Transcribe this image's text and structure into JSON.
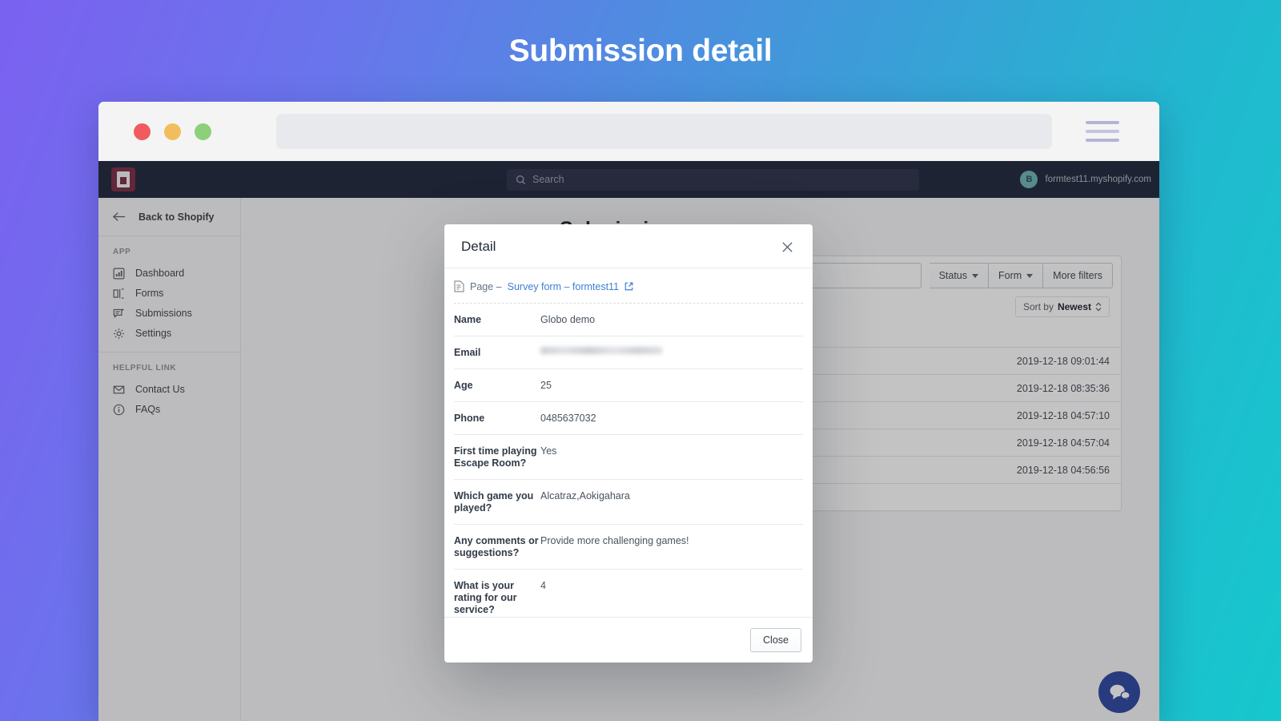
{
  "banner": {
    "title": "Submission detail"
  },
  "browser": {
    "traffic_lights": [
      {
        "name": "close",
        "color": "#fc5d60"
      },
      {
        "name": "minimize",
        "color": "#fdc75f"
      },
      {
        "name": "zoom",
        "color": "#93da7e"
      }
    ],
    "url_value": "",
    "menu_icon": "hamburger-menu-icon"
  },
  "topnav": {
    "logo_icon": "globo-forms-logo",
    "search": {
      "placeholder": "Search",
      "value": "",
      "icon": "search-icon"
    },
    "account": {
      "initial": "B",
      "name": "formtest11.myshopify.com"
    }
  },
  "sidebar": {
    "back": {
      "label": "Back to Shopify",
      "icon": "arrow-left-icon"
    },
    "groups": [
      {
        "heading": "APP",
        "items": [
          {
            "label": "Dashboard",
            "icon": "chart-bar-icon"
          },
          {
            "label": "Forms",
            "icon": "form-icon"
          },
          {
            "label": "Submissions",
            "icon": "submissions-icon"
          },
          {
            "label": "Settings",
            "icon": "gear-icon"
          }
        ]
      },
      {
        "heading": "HELPFUL LINK",
        "items": [
          {
            "label": "Contact Us",
            "icon": "envelope-icon"
          },
          {
            "label": "FAQs",
            "icon": "info-circle-icon"
          }
        ]
      }
    ]
  },
  "main": {
    "page_title": "Submissions",
    "filters": {
      "search_placeholder": "",
      "buttons": [
        {
          "label": "Status",
          "has_caret": true
        },
        {
          "label": "Form",
          "has_caret": true
        },
        {
          "label": "More filters",
          "has_caret": false
        }
      ],
      "sort": {
        "prefix": "Sort by",
        "value": "Newest",
        "icon": "sort-updown-icon"
      }
    },
    "table": {
      "rows": [
        {
          "date": "2019-12-18 09:01:44"
        },
        {
          "date": "2019-12-18 08:35:36"
        },
        {
          "date": "2019-12-18 04:57:10"
        },
        {
          "date": "2019-12-18 04:57:04"
        },
        {
          "date": "2019-12-18 04:56:56"
        }
      ]
    },
    "chat_widget": {
      "icon": "chat-bubbles-icon",
      "color": "#1e4be8"
    }
  },
  "modal": {
    "title": "Detail",
    "close_icon": "close-x-icon",
    "page_link": {
      "doc_icon": "document-icon",
      "prefix": "Page – ",
      "link_text": "Survey form – formtest11",
      "external_icon": "external-link-icon"
    },
    "fields": [
      {
        "label": "Name",
        "value": "Globo demo",
        "redacted": false
      },
      {
        "label": "Email",
        "value": "",
        "redacted": true
      },
      {
        "label": "Age",
        "value": "25",
        "redacted": false
      },
      {
        "label": "Phone",
        "value": "0485637032",
        "redacted": false
      },
      {
        "label": "First time playing Escape Room?",
        "value": "Yes",
        "redacted": false
      },
      {
        "label": "Which game you played?",
        "value": "Alcatraz,Aokigahara",
        "redacted": false
      },
      {
        "label": "Any comments or suggestions?",
        "value": "Provide more challenging games!",
        "redacted": false
      },
      {
        "label": "What is your rating for our service?",
        "value": "4",
        "redacted": false
      }
    ],
    "close_button": "Close"
  }
}
